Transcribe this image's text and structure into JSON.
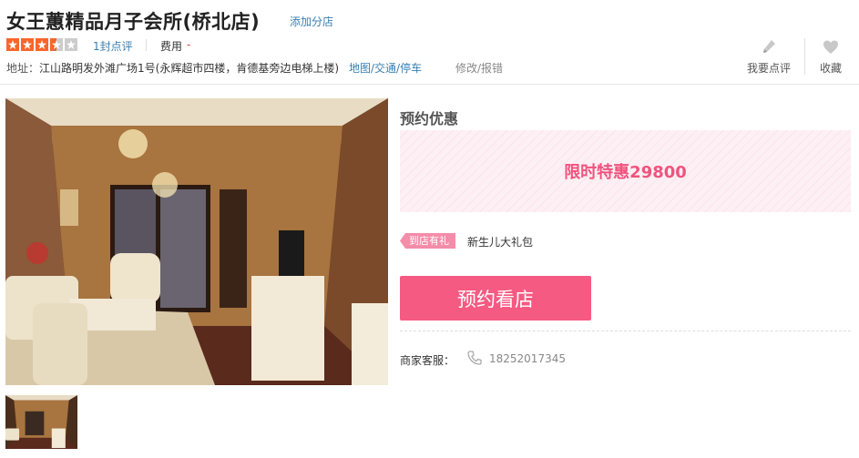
{
  "shop": {
    "title": "女王蕙精品月子会所(桥北店)",
    "add_branch": "添加分店",
    "rating_stars": 3.5,
    "review_count": "1封点评",
    "fee_label": "费用",
    "fee_value": "-",
    "address_label": "地址：",
    "address": "江山路明发外滩广场1号(永辉超市四楼，肯德基旁边电梯上楼)",
    "map_link": "地图/交通/停车",
    "report_link": "修改/报错"
  },
  "actions": {
    "write_review": "我要点评",
    "favorite": "收藏"
  },
  "booking": {
    "section_title": "预约优惠",
    "promo": "限时特惠29800",
    "gift_tag": "到店有礼",
    "gift_text": "新生儿大礼包",
    "book_button": "预约看店",
    "service_label": "商家客服：",
    "phone": "18252017345"
  },
  "colors": {
    "accent": "#f55a82",
    "link": "#3a7fb1",
    "star": "#f8662b",
    "promo_text": "#f0537e"
  },
  "icons": {
    "write_review": "pencil-icon",
    "favorite": "heart-icon",
    "phone": "phone-icon"
  }
}
